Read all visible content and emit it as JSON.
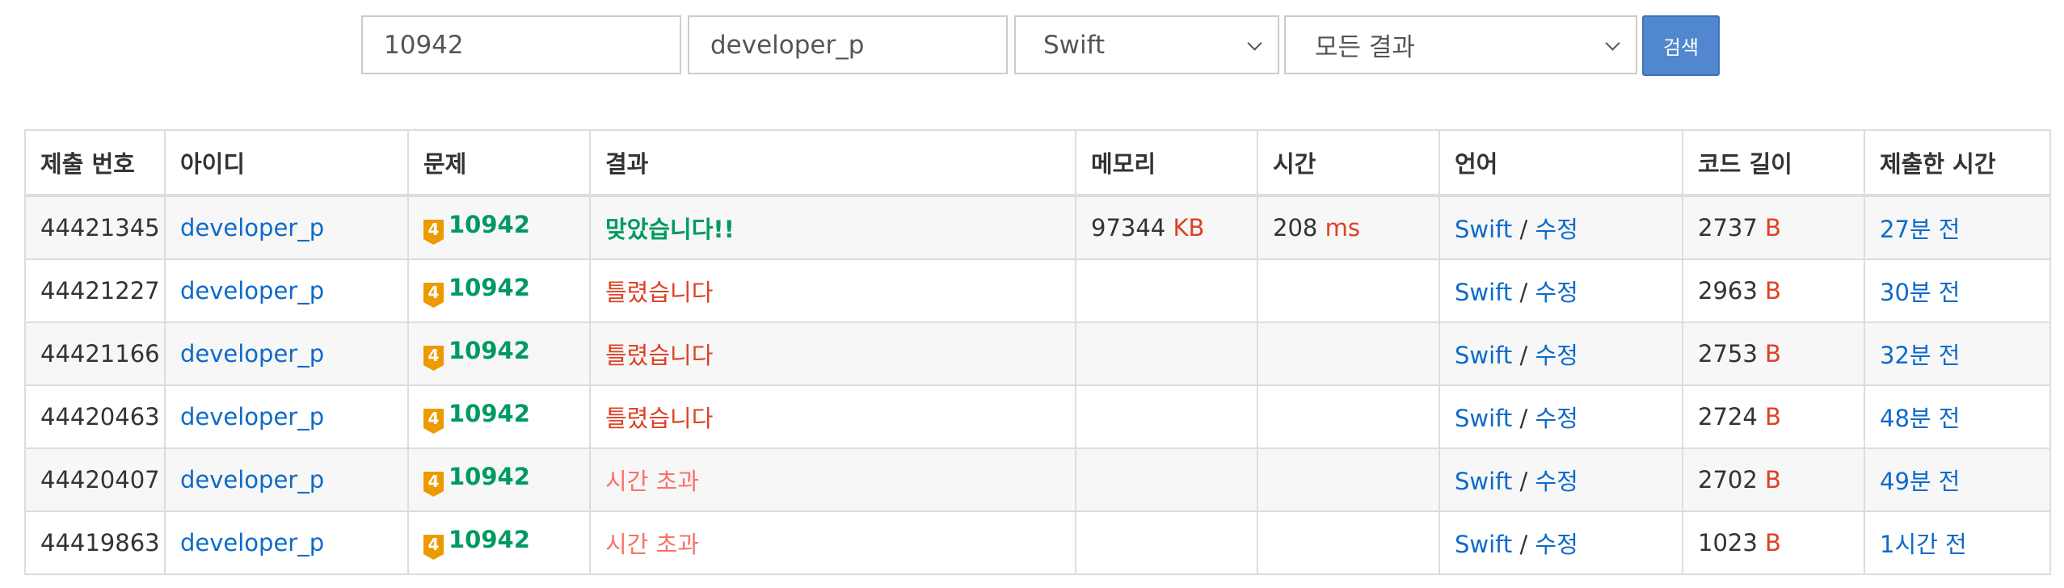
{
  "search": {
    "problem_id": "10942",
    "user_id": "developer_p",
    "language": "Swift",
    "result_filter": "모든 결과",
    "button_label": "검색"
  },
  "table": {
    "headers": [
      "제출 번호",
      "아이디",
      "문제",
      "결과",
      "메모리",
      "시간",
      "언어",
      "코드 길이",
      "제출한 시간"
    ],
    "rows": [
      {
        "id": "44421345",
        "user": "developer_p",
        "tier": "4",
        "problem": "10942",
        "result": "맞았습니다!!",
        "memory": "97344",
        "memory_unit": "KB",
        "time": "208",
        "time_unit": "ms",
        "lang": "Swift",
        "sep": "/",
        "edit": "수정",
        "length": "2737",
        "length_unit": "B",
        "submitted": "27분 전"
      },
      {
        "id": "44421227",
        "user": "developer_p",
        "tier": "4",
        "problem": "10942",
        "result": "틀렸습니다",
        "memory": "",
        "memory_unit": "",
        "time": "",
        "time_unit": "",
        "lang": "Swift",
        "sep": "/",
        "edit": "수정",
        "length": "2963",
        "length_unit": "B",
        "submitted": "30분 전"
      },
      {
        "id": "44421166",
        "user": "developer_p",
        "tier": "4",
        "problem": "10942",
        "result": "틀렸습니다",
        "memory": "",
        "memory_unit": "",
        "time": "",
        "time_unit": "",
        "lang": "Swift",
        "sep": "/",
        "edit": "수정",
        "length": "2753",
        "length_unit": "B",
        "submitted": "32분 전"
      },
      {
        "id": "44420463",
        "user": "developer_p",
        "tier": "4",
        "problem": "10942",
        "result": "틀렸습니다",
        "memory": "",
        "memory_unit": "",
        "time": "",
        "time_unit": "",
        "lang": "Swift",
        "sep": "/",
        "edit": "수정",
        "length": "2724",
        "length_unit": "B",
        "submitted": "48분 전"
      },
      {
        "id": "44420407",
        "user": "developer_p",
        "tier": "4",
        "problem": "10942",
        "result": "시간 초과",
        "memory": "",
        "memory_unit": "",
        "time": "",
        "time_unit": "",
        "lang": "Swift",
        "sep": "/",
        "edit": "수정",
        "length": "2702",
        "length_unit": "B",
        "submitted": "49분 전"
      },
      {
        "id": "44419863",
        "user": "developer_p",
        "tier": "4",
        "problem": "10942",
        "result": "시간 초과",
        "memory": "",
        "memory_unit": "",
        "time": "",
        "time_unit": "",
        "lang": "Swift",
        "sep": "/",
        "edit": "수정",
        "length": "1023",
        "length_unit": "B",
        "submitted": "1시간 전"
      }
    ]
  },
  "colors": {
    "link": "#0d6ac9",
    "accepted": "#009a61",
    "wrong": "#dd4124",
    "time_limit": "#fa7268",
    "unit": "#dd4124",
    "tier_badge": "#ec9a00",
    "button": "#5187ce"
  }
}
